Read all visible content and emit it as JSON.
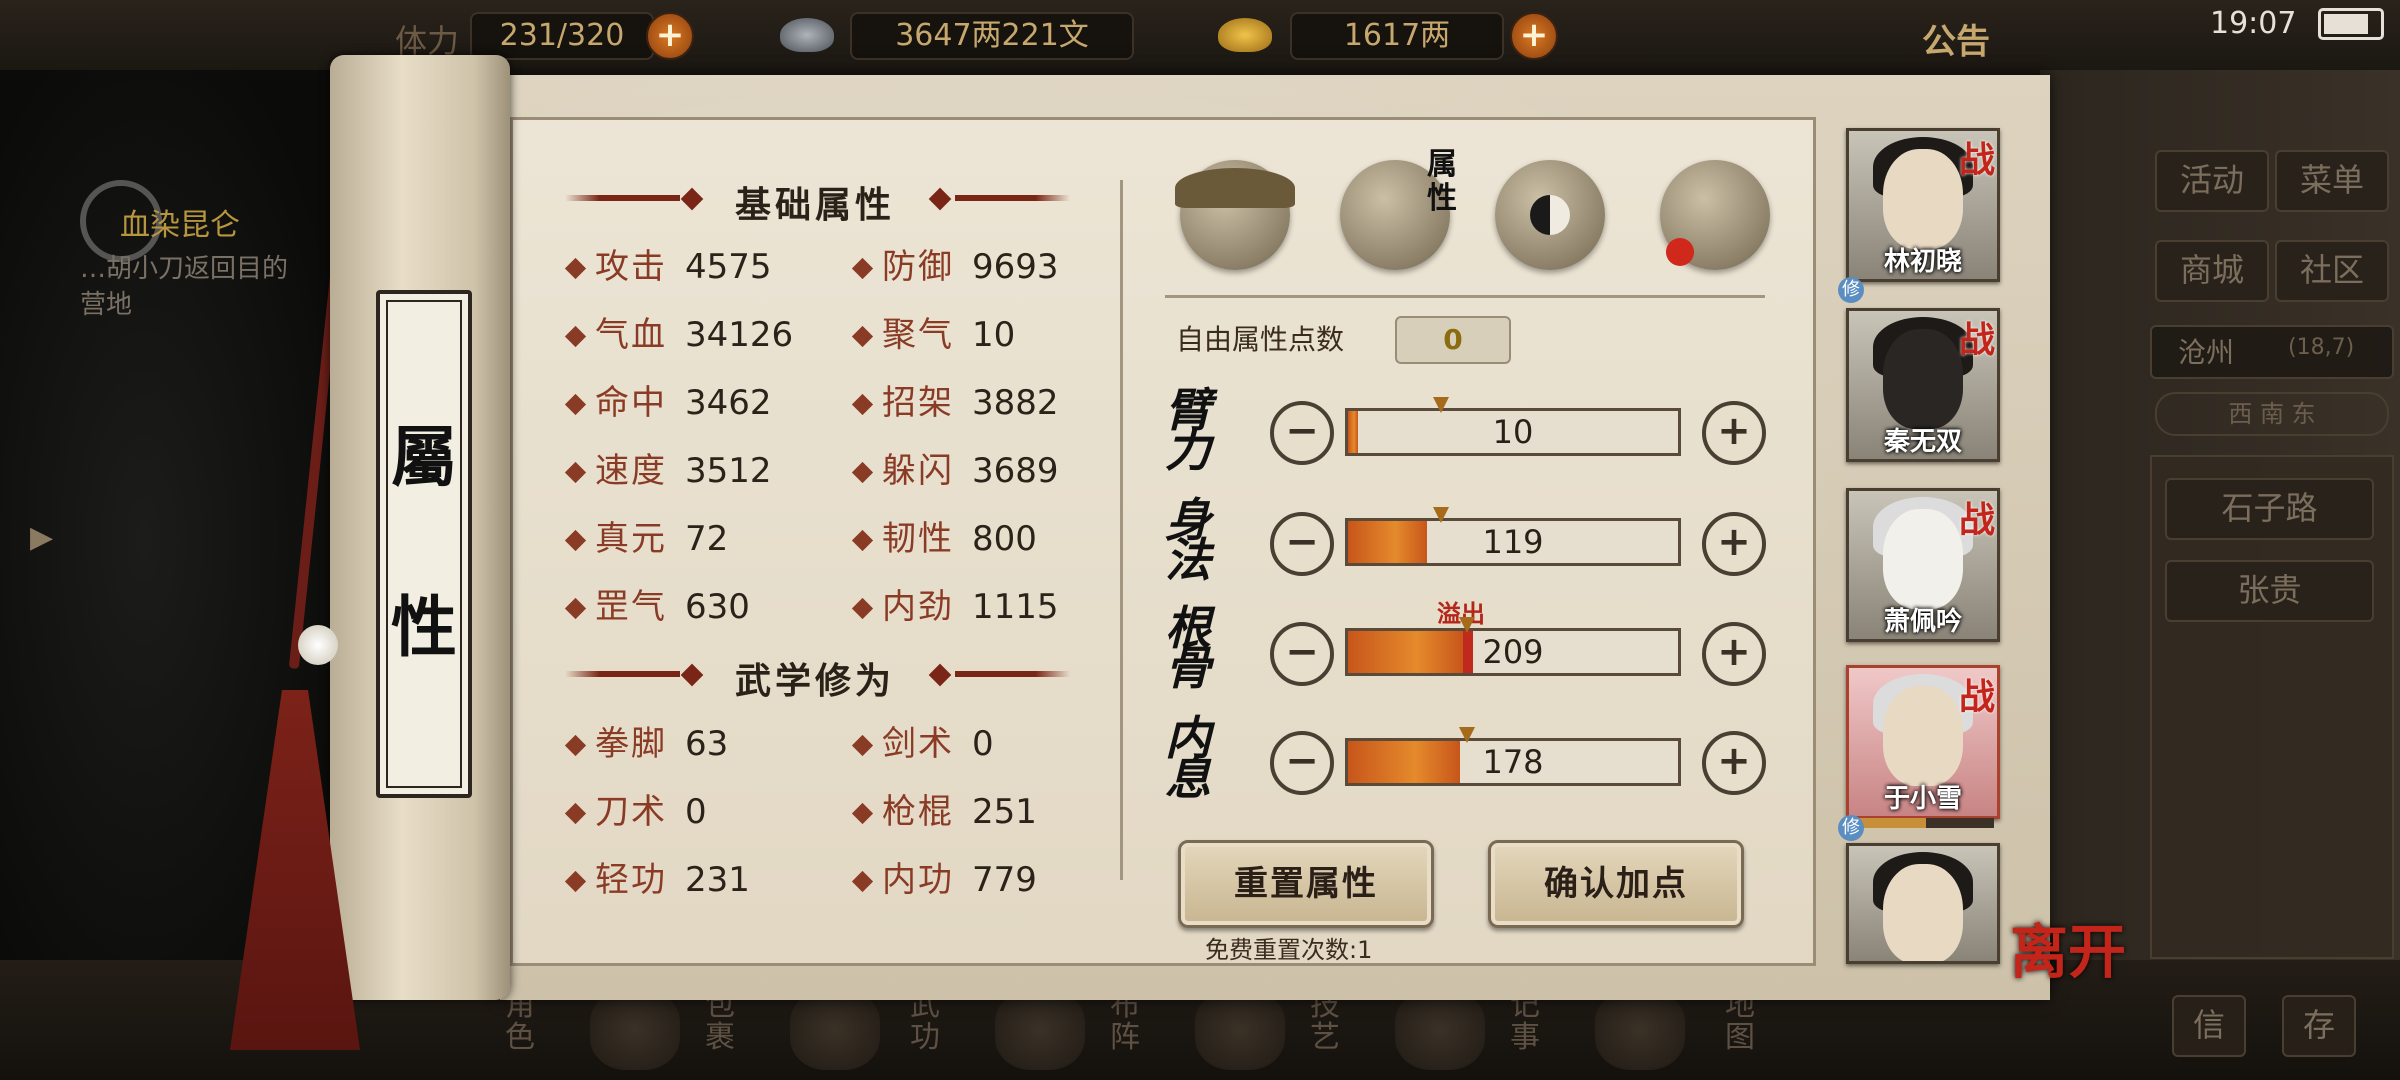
{
  "top_bar": {
    "stamina_label": "体力",
    "stamina_value": "231/320",
    "silver": "3647两221文",
    "gold": "1617两",
    "notice": "公告",
    "time": "19:07"
  },
  "quest": {
    "title": "血染昆仑",
    "desc_line1": "…胡小刀返回目的",
    "desc_line2": "营地"
  },
  "scroll_label": [
    "屬",
    "性"
  ],
  "basic": {
    "title": "基础属性",
    "stats": [
      {
        "name": "攻击",
        "value": "4575"
      },
      {
        "name": "防御",
        "value": "9693"
      },
      {
        "name": "气血",
        "value": "34126"
      },
      {
        "name": "聚气",
        "value": "10"
      },
      {
        "name": "命中",
        "value": "3462"
      },
      {
        "name": "招架",
        "value": "3882"
      },
      {
        "name": "速度",
        "value": "3512"
      },
      {
        "name": "躲闪",
        "value": "3689"
      },
      {
        "name": "真元",
        "value": "72"
      },
      {
        "name": "韧性",
        "value": "800"
      },
      {
        "name": "罡气",
        "value": "630"
      },
      {
        "name": "内劲",
        "value": "1115"
      }
    ]
  },
  "martial": {
    "title": "武学修为",
    "stats": [
      {
        "name": "拳脚",
        "value": "63"
      },
      {
        "name": "剑术",
        "value": "0"
      },
      {
        "name": "刀术",
        "value": "0"
      },
      {
        "name": "枪棍",
        "value": "251"
      },
      {
        "name": "轻功",
        "value": "231"
      },
      {
        "name": "内功",
        "value": "779"
      }
    ]
  },
  "tabs": {
    "attribute_label": [
      "属",
      "性"
    ]
  },
  "free_points": {
    "label": "自由属性点数",
    "value": "0"
  },
  "attributes": [
    {
      "label": [
        "臂",
        "力"
      ],
      "value": "10",
      "fill": 0.03,
      "over": 0
    },
    {
      "label": [
        "身",
        "法"
      ],
      "value": "119",
      "fill": 0.24,
      "over": 0
    },
    {
      "label": [
        "根",
        "骨"
      ],
      "value": "209",
      "fill": 0.35,
      "over": 0.03,
      "note": "溢出"
    },
    {
      "label": [
        "内",
        "息"
      ],
      "value": "178",
      "fill": 0.34,
      "over": 0
    }
  ],
  "buttons": {
    "reset": "重置属性",
    "confirm": "确认加点",
    "free_reset": "免费重置次数:1",
    "minus": "−",
    "plus": "+"
  },
  "party": [
    {
      "name": "林初晓",
      "tag": "战",
      "xiu": "修"
    },
    {
      "name": "秦无双",
      "tag": "战"
    },
    {
      "name": "萧佩吟",
      "tag": "战"
    },
    {
      "name": "于小雪",
      "tag": "战",
      "xiu": "修"
    },
    {
      "name": "",
      "tag": ""
    }
  ],
  "leave": "离开",
  "right_menu": {
    "activity": "活动",
    "menu": "菜单",
    "shop": "商城",
    "community": "社区",
    "location": "沧州",
    "coords": "(18,7)",
    "compass": "西 南 东",
    "npc1": "石子路",
    "npc2": "张贵",
    "bottom1": "信",
    "bottom2": "存"
  },
  "bottom_nav": [
    {
      "label": [
        "角",
        "色"
      ]
    },
    {
      "label": [
        "包",
        "裹"
      ]
    },
    {
      "label": [
        "武",
        "功"
      ]
    },
    {
      "label": [
        "布",
        "阵"
      ]
    },
    {
      "label": [
        "技",
        "艺"
      ]
    },
    {
      "label": [
        "记",
        "事"
      ]
    },
    {
      "label": [
        "地",
        "图"
      ]
    }
  ]
}
